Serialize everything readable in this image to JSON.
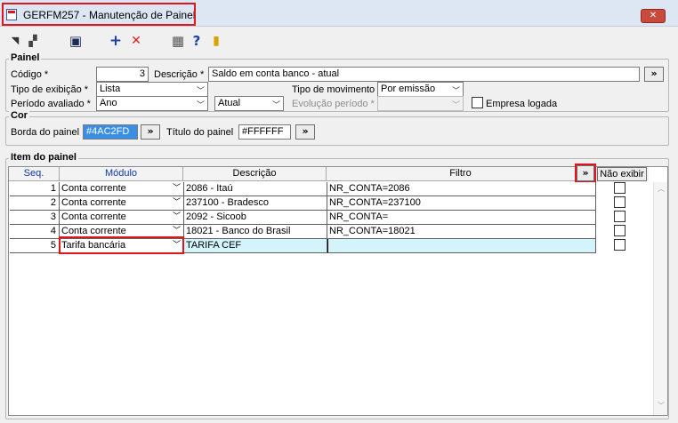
{
  "window": {
    "title": "GERFM257 - Manutenção de Painel",
    "close_glyph": "✕"
  },
  "toolbar": {
    "buttons": [
      {
        "icon": "first-record-icon",
        "glyph": "◥"
      },
      {
        "icon": "copy-record-icon",
        "glyph": "▞"
      },
      {
        "icon": "save-icon",
        "glyph": "▣"
      },
      {
        "icon": "add-icon",
        "glyph": "+"
      },
      {
        "icon": "delete-icon",
        "glyph": "✕"
      },
      {
        "icon": "table-icon",
        "glyph": "▦"
      },
      {
        "icon": "help-icon",
        "glyph": "?"
      },
      {
        "icon": "exit-door-icon",
        "glyph": "▮"
      }
    ]
  },
  "painel": {
    "group_label": "Painel",
    "codigo_label": "Código *",
    "codigo_value": "3",
    "descricao_label": "Descrição *",
    "descricao_value": "Saldo em conta banco - atual",
    "descricao_button": "»",
    "tipo_exibicao_label": "Tipo de exibição *",
    "tipo_exibicao_value": "Lista",
    "tipo_movimento_label": "Tipo de movimento",
    "tipo_movimento_value": "Por emissão",
    "periodo_label": "Período avaliado *",
    "periodo_value": "Ano",
    "periodo2_value": "Atual",
    "evolucao_label": "Evolução período *",
    "evolucao_value": "",
    "empresa_logada_label": "Empresa logada",
    "empresa_logada_checked": false
  },
  "cor": {
    "group_label": "Cor",
    "borda_label": "Borda do painel",
    "borda_value": "#4AC2FD",
    "borda_button": "»",
    "titulo_label": "Título do painel",
    "titulo_value": "#FFFFFF",
    "titulo_button": "»"
  },
  "itens": {
    "group_label": "Item do painel",
    "filter_button": "»",
    "columns": {
      "seq": "Seq.",
      "modulo": "Módulo",
      "descricao": "Descrição",
      "filtro": "Filtro",
      "nao_exibir": "Não exibir"
    },
    "rows": [
      {
        "seq": "1",
        "modulo": "Conta corrente",
        "descricao": "2086 - Itaú",
        "filtro": "NR_CONTA=2086"
      },
      {
        "seq": "2",
        "modulo": "Conta corrente",
        "descricao": "237100 - Bradesco",
        "filtro": "NR_CONTA=237100"
      },
      {
        "seq": "3",
        "modulo": "Conta corrente",
        "descricao": "2092 - Sicoob",
        "filtro": "NR_CONTA="
      },
      {
        "seq": "4",
        "modulo": "Conta corrente",
        "descricao": "18021 - Banco do Brasil",
        "filtro": "NR_CONTA=18021"
      },
      {
        "seq": "5",
        "modulo": "Tarifa bancária",
        "descricao": "TARIFA CEF",
        "filtro": ""
      }
    ]
  },
  "glyphs": {
    "combo_arrow": "﹀",
    "scroll_up": "︿",
    "scroll_down": "﹀"
  },
  "colors": {
    "highlight_red": "#e0161c",
    "selected_row": "#d4f4fb",
    "header_blue": "#0b3aa4",
    "color_field_selected": "#3a8ee6"
  }
}
